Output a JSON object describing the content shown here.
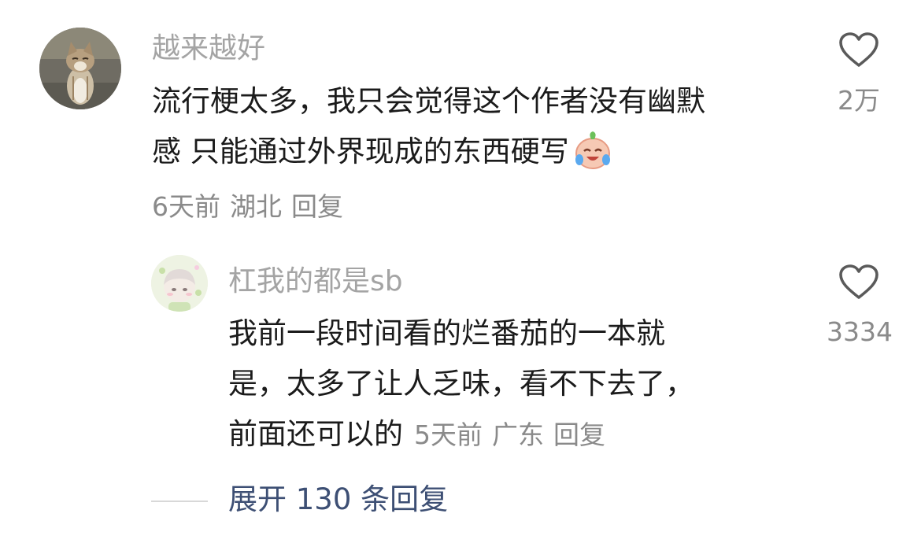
{
  "comment": {
    "username": "越来越好",
    "text_line1": "流行梗太多，我只会觉得这个作者没有幽默",
    "text_line2": "感 只能通过外界现成的东西硬写",
    "emoji": "laughing-crying-emoji",
    "time": "6天前",
    "location": "湖北",
    "reply_label": "回复",
    "like_count": "2万",
    "like_icon": "heart-outline-icon"
  },
  "reply": {
    "username": "杠我的都是sb",
    "text_line1": "我前一段时间看的烂番茄的一本就",
    "text_line2": "是，太多了让人乏味，看不下去了，",
    "text_line3": "前面还可以的",
    "time": "5天前",
    "location": "广东",
    "reply_label": "回复",
    "like_count": "3334",
    "like_icon": "heart-outline-icon"
  },
  "expand": {
    "label": "展开 130 条回复"
  },
  "colors": {
    "username": "#a4a4a4",
    "meta": "#8a8a8a",
    "expand_link": "#3d4f74",
    "text": "#1b1b1b"
  }
}
